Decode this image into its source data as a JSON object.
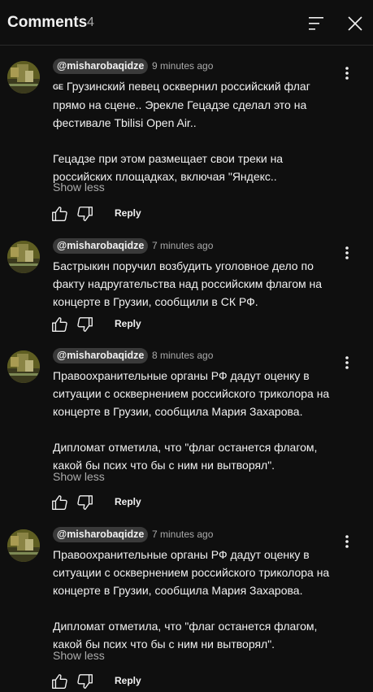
{
  "header": {
    "title": "Comments",
    "count": "4"
  },
  "comments": [
    {
      "author": "@misharobaqidze",
      "time": "9 minutes ago",
      "flag_prefix": "GE",
      "paragraphs": [
        "Грузинский певец осквернил российский флаг прямо на сцене.. Эрекле Гецадзе сделал это на фестивале Tbilisi Open Air..",
        "Гецадзе при этом размещает свои треки на российских площадках, включая \"Яндекс.."
      ],
      "show_less": "Show less",
      "reply": "Reply"
    },
    {
      "author": "@misharobaqidze",
      "time": "7 minutes ago",
      "paragraphs": [
        "Бастрыкин поручил возбудить уголовное дело по факту надругательства над российским флагом на концерте в Грузии, сообщили в СК РФ."
      ],
      "reply": "Reply"
    },
    {
      "author": "@misharobaqidze",
      "time": "8 minutes ago",
      "paragraphs": [
        "Правоохранительные органы РФ дадут оценку в ситуации с осквернением российского триколора на концерте в Грузии, сообщила Мария Захарова.",
        "Дипломат отметила, что \"флаг останется флагом, какой бы псих что бы с ним ни вытворял\"."
      ],
      "show_less": "Show less",
      "reply": "Reply"
    },
    {
      "author": "@misharobaqidze",
      "time": "7 minutes ago",
      "paragraphs": [
        "Правоохранительные органы РФ дадут оценку в ситуации с осквернением российского триколора на концерте в Грузии, сообщила Мария Захарова.",
        "Дипломат отметила, что \"флаг останется флагом, какой бы псих что бы с ним ни вытворял\"."
      ],
      "show_less": "Show less",
      "reply": "Reply"
    }
  ],
  "icons": {
    "sort": "sort-icon",
    "close": "close-icon",
    "more": "more-vert-icon",
    "like": "thumb-up-icon",
    "dislike": "thumb-down-icon"
  },
  "colors": {
    "background": "#0f0f0f",
    "text_primary": "#f1f1f1",
    "text_secondary": "#aaaaaa",
    "author_pill": "#3a3a3a"
  }
}
